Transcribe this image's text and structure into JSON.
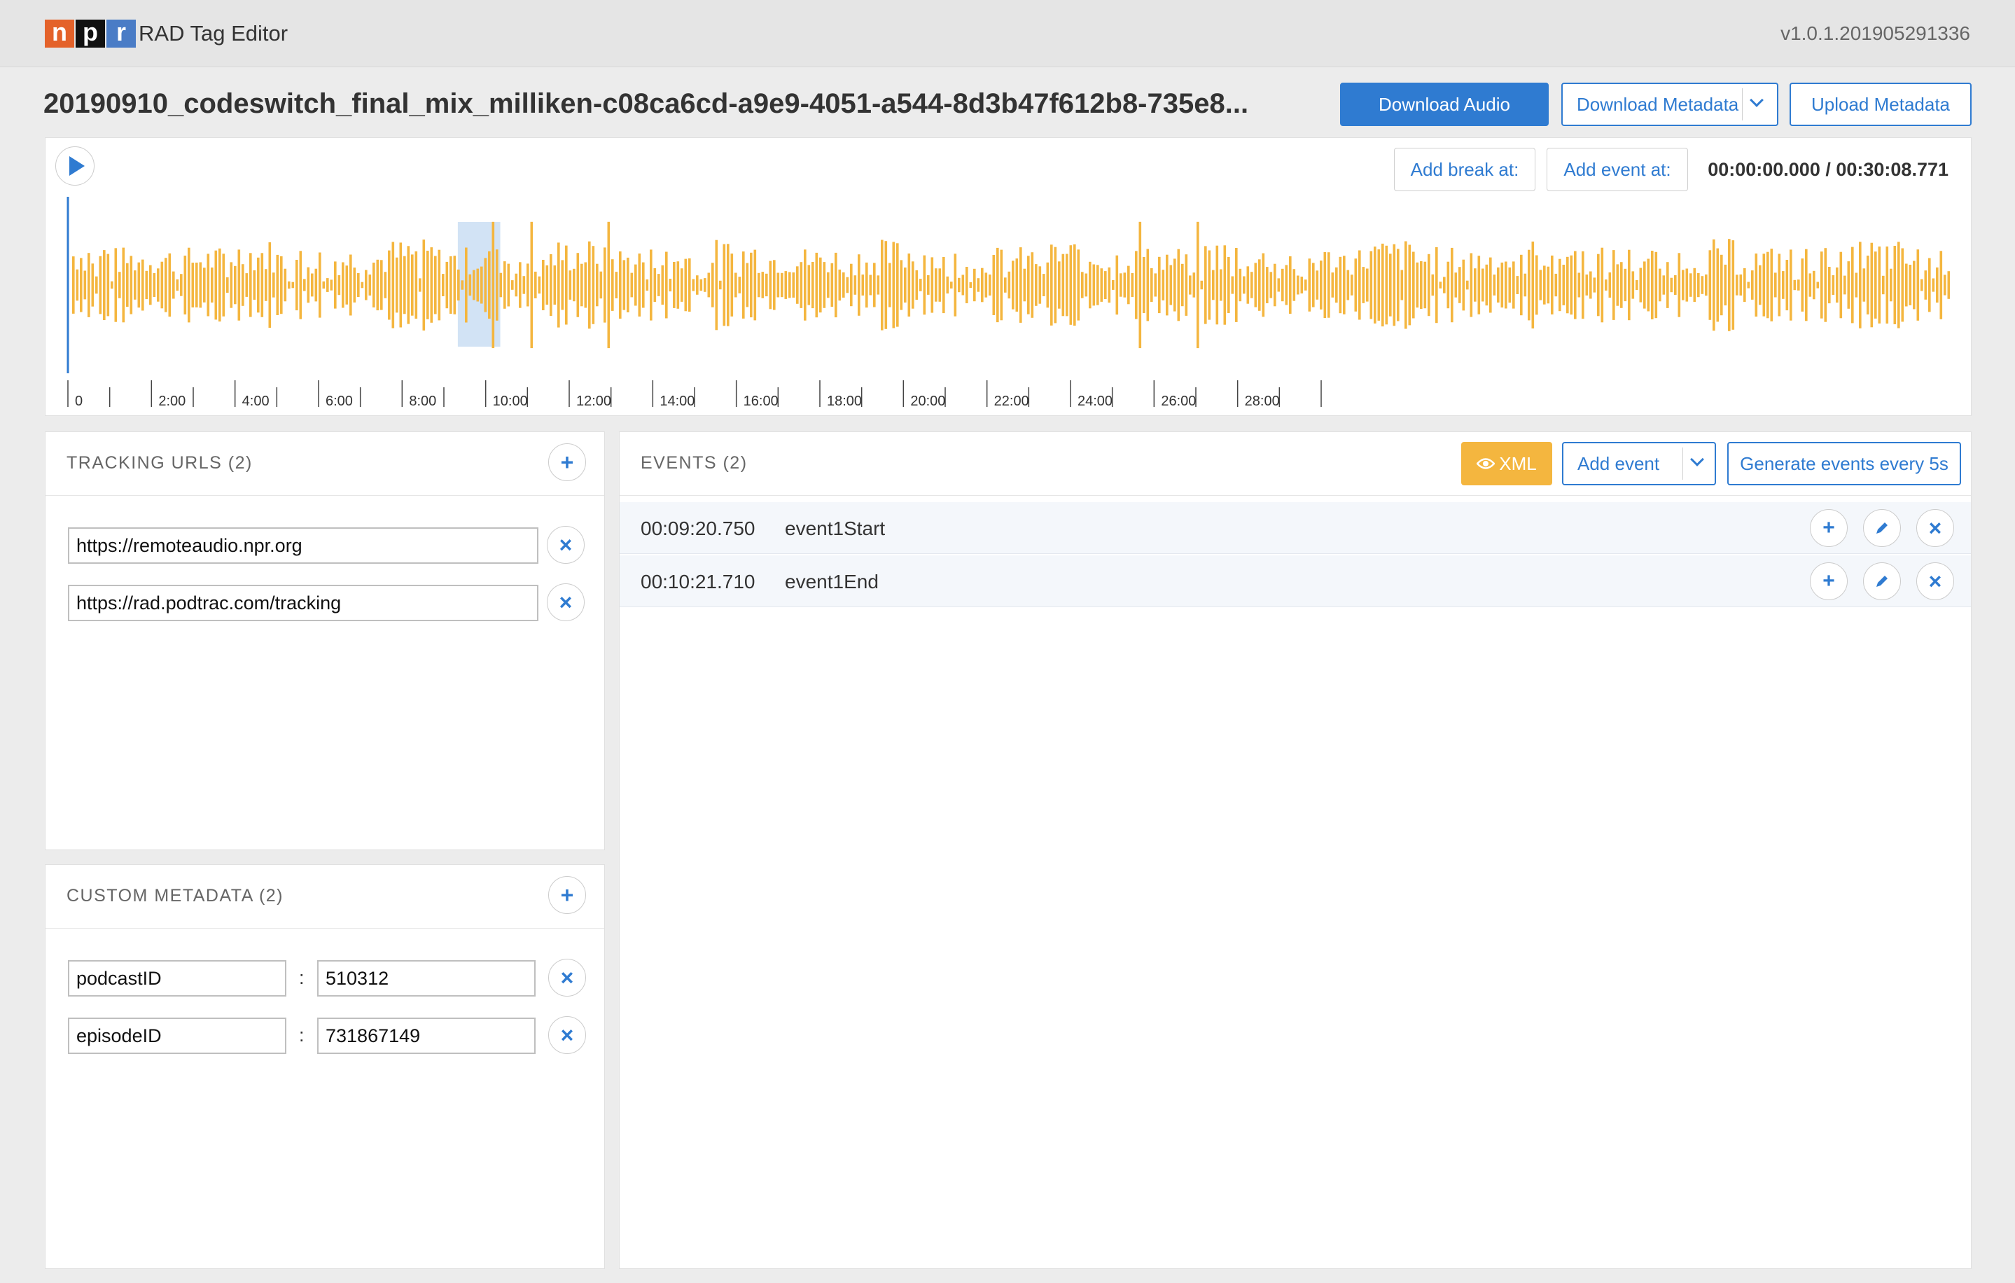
{
  "app": {
    "logo_letters": [
      "n",
      "p",
      "r"
    ],
    "name": "RAD Tag Editor",
    "version": "v1.0.1.201905291336"
  },
  "file": {
    "title": "20190910_codeswitch_final_mix_milliken-c08ca6cd-a9e9-4051-a544-8d3b47f612b8-735e8..."
  },
  "toolbar": {
    "download_audio": "Download Audio",
    "download_metadata": "Download Metadata",
    "upload_metadata": "Upload Metadata"
  },
  "player": {
    "add_break": "Add break at:",
    "add_event": "Add event at:",
    "current_time": "00:00:00.000",
    "total_time": "00:30:08.771",
    "time_separator": " / ",
    "axis_ticks": [
      "0",
      "2:00",
      "4:00",
      "6:00",
      "8:00",
      "10:00",
      "12:00",
      "14:00",
      "16:00",
      "18:00",
      "20:00",
      "22:00",
      "24:00",
      "26:00",
      "28:00"
    ],
    "selected_region_seconds": [
      560,
      621
    ],
    "duration_seconds": 1808.771,
    "waveform_color": "#f4b63f",
    "selection_color": "#d2e3f5"
  },
  "tracking": {
    "title": "TRACKING URLS (2)",
    "urls": [
      "https://remoteaudio.npr.org",
      "https://rad.podtrac.com/tracking"
    ]
  },
  "metadata": {
    "title": "CUSTOM METADATA (2)",
    "entries": [
      {
        "key": "podcastID",
        "value": "510312"
      },
      {
        "key": "episodeID",
        "value": "731867149"
      }
    ]
  },
  "events": {
    "title": "EVENTS (2)",
    "xml_button": "XML",
    "add_event": "Add event",
    "generate": "Generate events every 5s",
    "items": [
      {
        "time": "00:09:20.750",
        "name": "event1Start"
      },
      {
        "time": "00:10:21.710",
        "name": "event1End"
      }
    ]
  },
  "colors": {
    "accent": "#2f7bd1",
    "warning": "#f4b63f"
  },
  "icons": {
    "play": "play-icon",
    "add": "plus-icon",
    "remove": "close-icon",
    "edit": "pencil-icon",
    "eye": "eye-icon",
    "chevron": "chevron-down-icon"
  }
}
